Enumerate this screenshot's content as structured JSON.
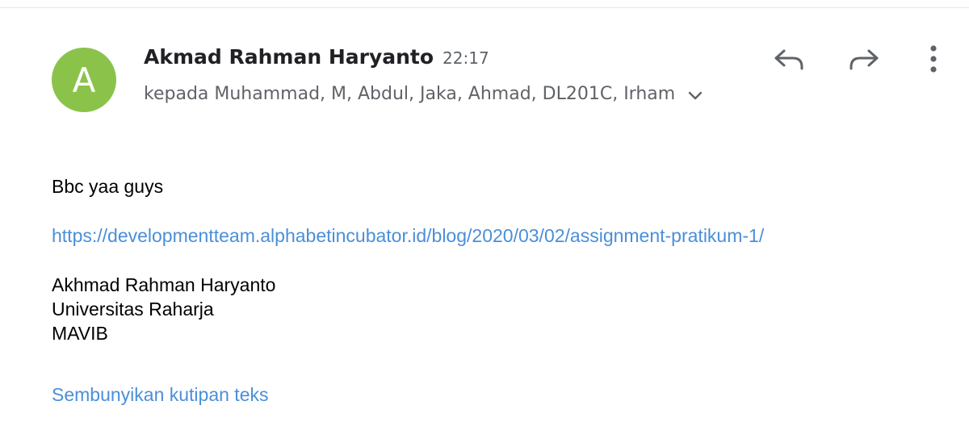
{
  "sender": {
    "avatar_initial": "A",
    "avatar_color": "#8bc34a",
    "name": "Akmad Rahman Haryanto",
    "time": "22:17"
  },
  "recipients_text": "kepada Muhammad, M, Abdul, Jaka, Ahmad, DL201C, Irham",
  "actions": {
    "reply_icon": "reply-icon",
    "forward_icon": "forward-icon",
    "more_icon": "more-vert-icon"
  },
  "message": {
    "greeting": "Bbc yaa guys",
    "link": "https://developmentteam.alphabetincubator.id/blog/2020/03/02/assignment-pratikum-1/",
    "signature": [
      "Akhmad Rahman Haryanto",
      "Universitas Raharja",
      "MAVIB"
    ],
    "hide_quoted": "Sembunyikan kutipan teks"
  },
  "colors": {
    "link": "#4a8fd9",
    "secondary_text": "#5f6368",
    "icon": "#5f6368"
  }
}
